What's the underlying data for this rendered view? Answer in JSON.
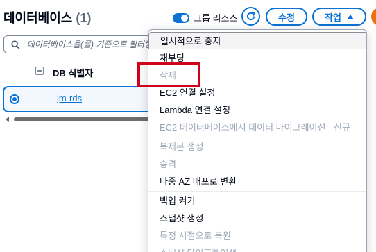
{
  "header": {
    "title": "데이터베이스",
    "count": "(1)",
    "toggle_label": "그룹 리소스",
    "toggle_on": true,
    "edit_label": "수정",
    "action_label": "작업"
  },
  "search": {
    "placeholder": "데이터베이스을(를) 기준으로 필터링"
  },
  "table": {
    "column_header": "DB 식별자",
    "rows": [
      {
        "id": "jm-rds",
        "selected": true
      }
    ]
  },
  "menu": {
    "groups": [
      [
        {
          "label": "일시적으로 중지",
          "disabled": false
        },
        {
          "label": "재부팅",
          "disabled": false
        },
        {
          "label": "삭제",
          "disabled": true
        },
        {
          "label": "EC2 연결 설정",
          "disabled": false
        },
        {
          "label": "Lambda 연결 설정",
          "disabled": false
        },
        {
          "label": "EC2 데이터베이스에서 데이터 마이그레이션 - 신규",
          "disabled": true
        }
      ],
      [
        {
          "label": "복제본 생성",
          "disabled": true
        },
        {
          "label": "승격",
          "disabled": true
        },
        {
          "label": "다중 AZ 배포로 변환",
          "disabled": false
        }
      ],
      [
        {
          "label": "백업 켜기",
          "disabled": false
        },
        {
          "label": "스냅샷 생성",
          "disabled": false
        },
        {
          "label": "특정 시점으로 복원",
          "disabled": true
        },
        {
          "label": "스냅샷 마이그레이션",
          "disabled": true
        }
      ]
    ]
  },
  "colors": {
    "accent": "#0972d3",
    "highlight": "#d0021b",
    "disabled_text": "#9ba7b6",
    "orange": "#ec7211"
  }
}
